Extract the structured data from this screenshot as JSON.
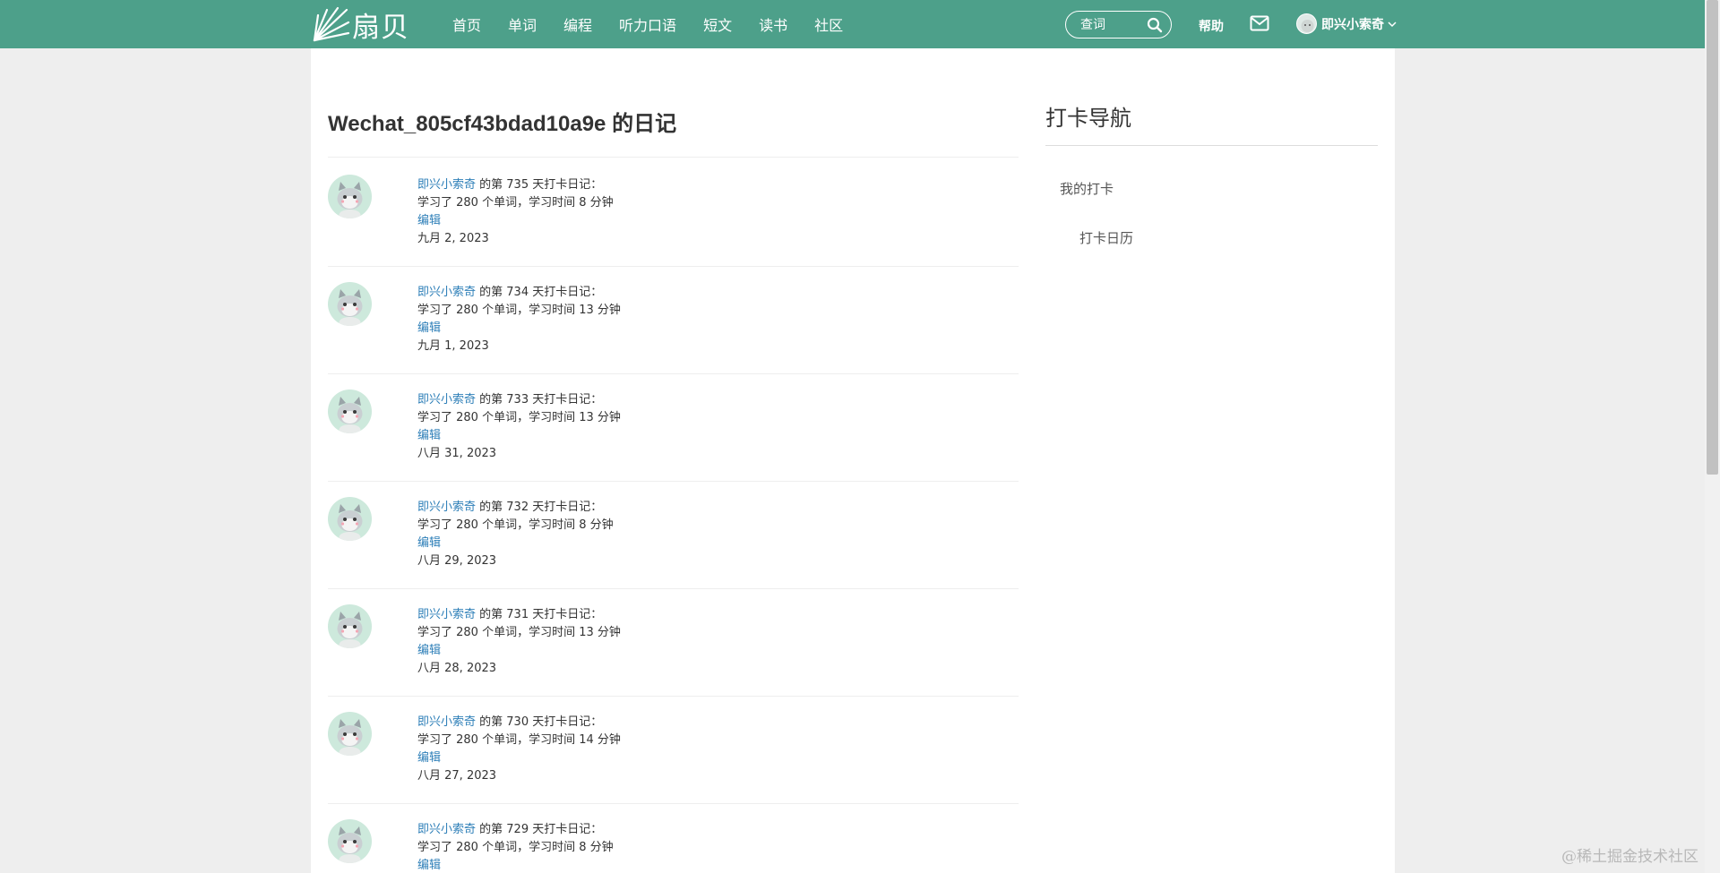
{
  "header": {
    "logo_text": "扇贝",
    "nav": [
      "首页",
      "单词",
      "编程",
      "听力口语",
      "短文",
      "读书",
      "社区"
    ],
    "search_placeholder": "查词",
    "help_label": "帮助",
    "user_name": "即兴小索奇"
  },
  "main": {
    "title": "Wechat_805cf43bdad10a9e 的日记",
    "edit_label": "编辑",
    "entries": [
      {
        "user": "即兴小索奇",
        "day_text": " 的第 735 天打卡日记：",
        "summary": "学习了 280 个单词，学习时间 8 分钟",
        "date": "九月 2, 2023"
      },
      {
        "user": "即兴小索奇",
        "day_text": " 的第 734 天打卡日记：",
        "summary": "学习了 280 个单词，学习时间 13 分钟",
        "date": "九月 1, 2023"
      },
      {
        "user": "即兴小索奇",
        "day_text": " 的第 733 天打卡日记：",
        "summary": "学习了 280 个单词，学习时间 13 分钟",
        "date": "八月 31, 2023"
      },
      {
        "user": "即兴小索奇",
        "day_text": " 的第 732 天打卡日记：",
        "summary": "学习了 280 个单词，学习时间 8 分钟",
        "date": "八月 29, 2023"
      },
      {
        "user": "即兴小索奇",
        "day_text": " 的第 731 天打卡日记：",
        "summary": "学习了 280 个单词，学习时间 13 分钟",
        "date": "八月 28, 2023"
      },
      {
        "user": "即兴小索奇",
        "day_text": " 的第 730 天打卡日记：",
        "summary": "学习了 280 个单词，学习时间 14 分钟",
        "date": "八月 27, 2023"
      },
      {
        "user": "即兴小索奇",
        "day_text": " 的第 729 天打卡日记：",
        "summary": "学习了 280 个单词，学习时间 8 分钟",
        "date": ""
      }
    ]
  },
  "sidebar": {
    "title": "打卡导航",
    "links": [
      "我的打卡",
      "打卡日历"
    ]
  },
  "watermark": "@稀土掘金技术社区",
  "colors": {
    "brand": "#4da08a",
    "link": "#2e7fb8"
  }
}
